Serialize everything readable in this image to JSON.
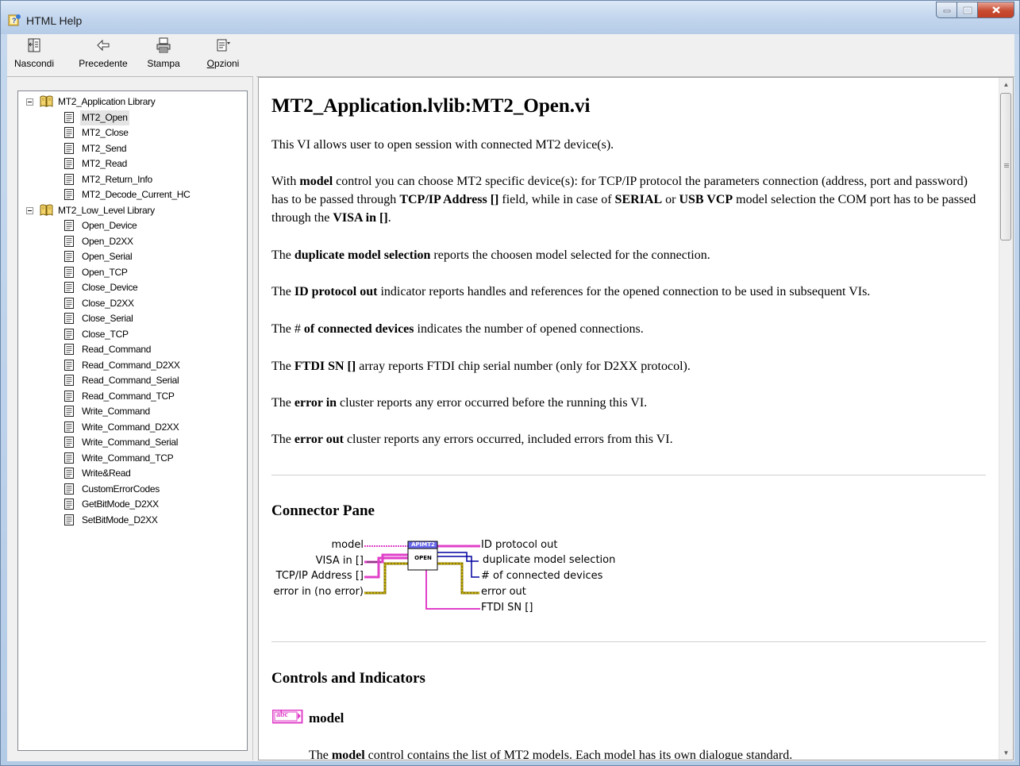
{
  "window": {
    "title": "HTML Help"
  },
  "toolbar": {
    "hide": "Nascondi",
    "back": "Precedente",
    "print": "Stampa",
    "options_prefix": "O",
    "options_rest": "pzioni"
  },
  "tree": {
    "app_library": "MT2_Application Library",
    "app_items": [
      "MT2_Open",
      "MT2_Close",
      "MT2_Send",
      "MT2_Read",
      "MT2_Return_Info",
      "MT2_Decode_Current_HC"
    ],
    "low_library": "MT2_Low_Level Library",
    "low_items": [
      "Open_Device",
      "Open_D2XX",
      "Open_Serial",
      "Open_TCP",
      "Close_Device",
      "Close_D2XX",
      "Close_Serial",
      "Close_TCP",
      "Read_Command",
      "Read_Command_D2XX",
      "Read_Command_Serial",
      "Read_Command_TCP",
      "Write_Command",
      "Write_Command_D2XX",
      "Write_Command_Serial",
      "Write_Command_TCP",
      "Write&Read",
      "CustomErrorCodes",
      "GetBitMode_D2XX",
      "SetBitMode_D2XX"
    ]
  },
  "doc": {
    "title": "MT2_Application.lvlib:MT2_Open.vi",
    "intro": "This VI allows user to open session with connected MT2 device(s).",
    "p_model": {
      "a": "With ",
      "b": "model",
      "c": " control you can choose MT2 specific device(s): for TCP/IP protocol the parameters connection (address, port and password) has to be passed through ",
      "d": "TCP/IP Address []",
      "e": " field, while in case of ",
      "f": "SERIAL",
      "g": " or ",
      "h": "USB VCP",
      "i": " model selection the COM port has to be passed through the ",
      "j": "VISA in []",
      "k": "."
    },
    "p_dup": {
      "a": "The ",
      "b": "duplicate model selection",
      "c": " reports the choosen model selected for the connection."
    },
    "p_id": {
      "a": "The ",
      "b": "ID protocol out",
      "c": " indicator reports handles and references for the opened connection to be used in subsequent VIs."
    },
    "p_num": {
      "a": "The # ",
      "b": "of connected devices",
      "c": " indicates the number of opened connections."
    },
    "p_ftdi": {
      "a": "The ",
      "b": "FTDI SN []",
      "c": " array reports FTDI chip serial number (only for D2XX protocol)."
    },
    "p_errin": {
      "a": "The ",
      "b": "error in",
      "c": " cluster reports any error occurred before the running this VI."
    },
    "p_errout": {
      "a": "The ",
      "b": "error out",
      "c": " cluster reports any errors occurred, included errors from this VI."
    },
    "connector_heading": "Connector Pane",
    "connector": {
      "left": [
        "model",
        "VISA in []",
        "TCP/IP Address []",
        "error in (no error)"
      ],
      "right": [
        "ID protocol out",
        "duplicate model selection",
        "# of connected devices",
        "error out",
        "FTDI SN []"
      ],
      "icon_top": "APIMT2",
      "icon_body": "OPEN"
    },
    "controls_heading": "Controls and Indicators",
    "abc_icon": "abc",
    "model_heading": "model",
    "model_desc": {
      "a": "The ",
      "b": "model",
      "c": " control contains the list of MT2 models. Each model has its own dialogue standard."
    }
  },
  "colors": {
    "string_wire": "#e040c8",
    "cluster_wire": "#8c7a00",
    "blue_wire": "#0000a0"
  }
}
